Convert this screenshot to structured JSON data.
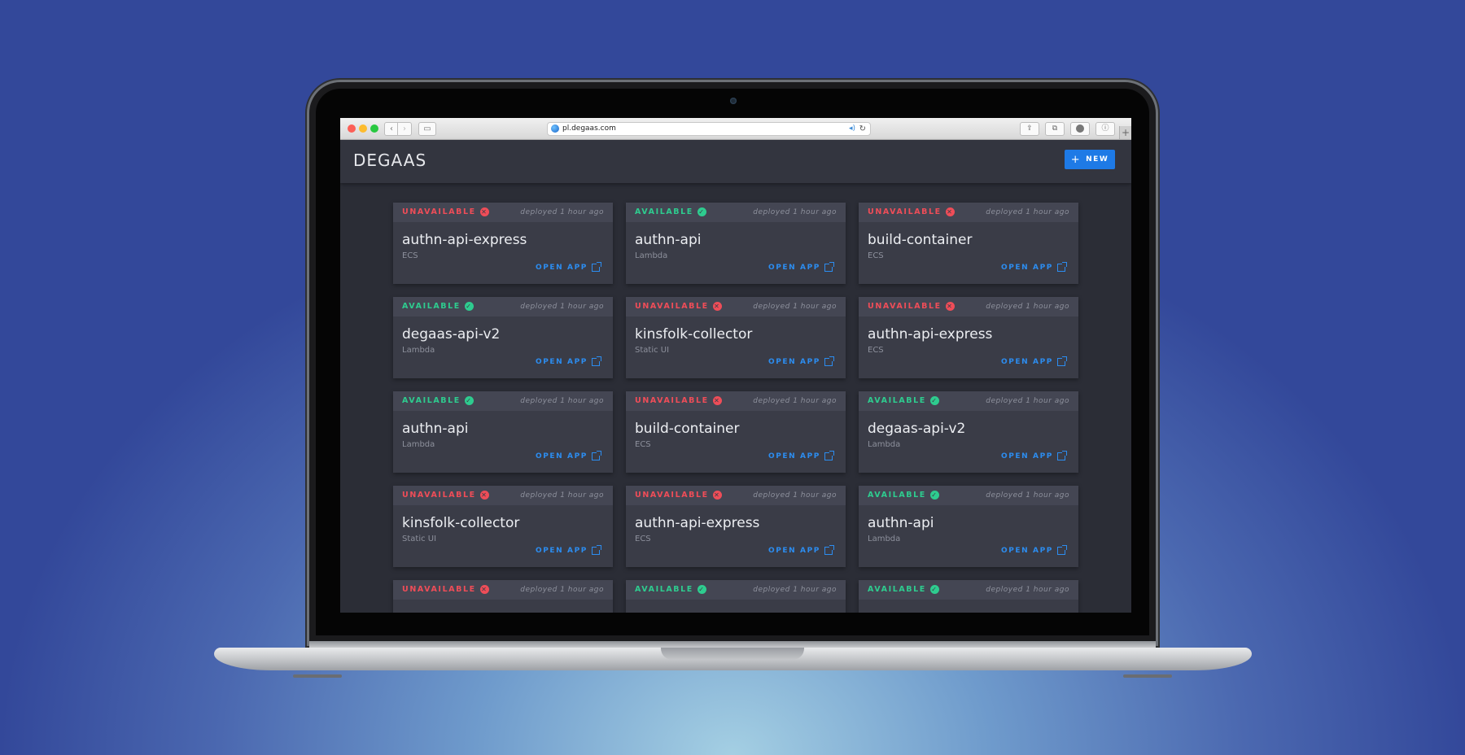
{
  "browser": {
    "url": "pl.degaas.com"
  },
  "app": {
    "brand": "DEGAAS",
    "new_button_label": "NEW"
  },
  "cards": [
    {
      "status": "UNAVAILABLE",
      "ok": false,
      "deployed": "deployed 1 hour ago",
      "name": "authn-api-express",
      "type": "ECS",
      "open_label": "OPEN APP"
    },
    {
      "status": "AVAILABLE",
      "ok": true,
      "deployed": "deployed 1 hour ago",
      "name": "authn-api",
      "type": "Lambda",
      "open_label": "OPEN APP"
    },
    {
      "status": "UNAVAILABLE",
      "ok": false,
      "deployed": "deployed 1 hour ago",
      "name": "build-container",
      "type": "ECS",
      "open_label": "OPEN APP"
    },
    {
      "status": "AVAILABLE",
      "ok": true,
      "deployed": "deployed 1 hour ago",
      "name": "degaas-api-v2",
      "type": "Lambda",
      "open_label": "OPEN APP"
    },
    {
      "status": "UNAVAILABLE",
      "ok": false,
      "deployed": "deployed 1 hour ago",
      "name": "kinsfolk-collector",
      "type": "Static UI",
      "open_label": "OPEN APP"
    },
    {
      "status": "UNAVAILABLE",
      "ok": false,
      "deployed": "deployed 1 hour ago",
      "name": "authn-api-express",
      "type": "ECS",
      "open_label": "OPEN APP"
    },
    {
      "status": "AVAILABLE",
      "ok": true,
      "deployed": "deployed 1 hour ago",
      "name": "authn-api",
      "type": "Lambda",
      "open_label": "OPEN APP"
    },
    {
      "status": "UNAVAILABLE",
      "ok": false,
      "deployed": "deployed 1 hour ago",
      "name": "build-container",
      "type": "ECS",
      "open_label": "OPEN APP"
    },
    {
      "status": "AVAILABLE",
      "ok": true,
      "deployed": "deployed 1 hour ago",
      "name": "degaas-api-v2",
      "type": "Lambda",
      "open_label": "OPEN APP"
    },
    {
      "status": "UNAVAILABLE",
      "ok": false,
      "deployed": "deployed 1 hour ago",
      "name": "kinsfolk-collector",
      "type": "Static UI",
      "open_label": "OPEN APP"
    },
    {
      "status": "UNAVAILABLE",
      "ok": false,
      "deployed": "deployed 1 hour ago",
      "name": "authn-api-express",
      "type": "ECS",
      "open_label": "OPEN APP"
    },
    {
      "status": "AVAILABLE",
      "ok": true,
      "deployed": "deployed 1 hour ago",
      "name": "authn-api",
      "type": "Lambda",
      "open_label": "OPEN APP"
    },
    {
      "status": "UNAVAILABLE",
      "ok": false,
      "deployed": "deployed 1 hour ago",
      "name": "",
      "type": "",
      "open_label": ""
    },
    {
      "status": "AVAILABLE",
      "ok": true,
      "deployed": "deployed 1 hour ago",
      "name": "",
      "type": "",
      "open_label": ""
    },
    {
      "status": "AVAILABLE",
      "ok": true,
      "deployed": "deployed 1 hour ago",
      "name": "",
      "type": "",
      "open_label": ""
    }
  ],
  "colors": {
    "available": "#2ecc8f",
    "unavailable": "#ef4d58",
    "accent": "#1e7ae6"
  }
}
